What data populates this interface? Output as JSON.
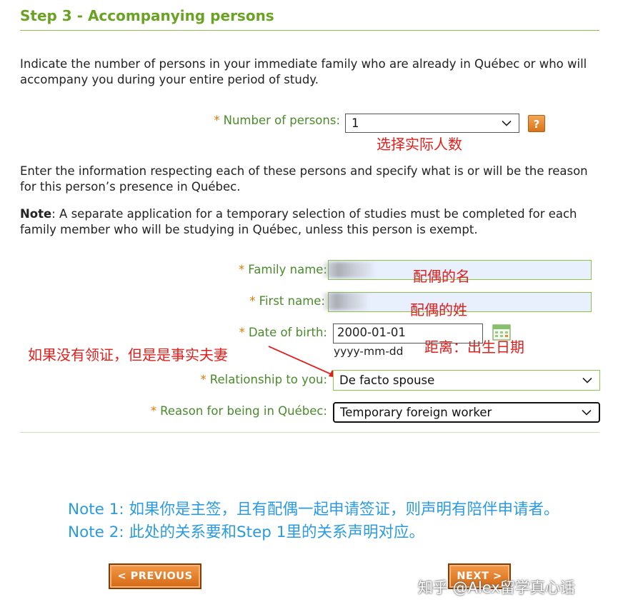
{
  "step_title": "Step 3 - Accompanying persons",
  "intro_text": "Indicate the number of persons in your immediate family who are already in Québec or who will accompany you during your entire period of study.",
  "number_of_persons": {
    "label": "Number of persons:",
    "value": "1",
    "help_label": "?"
  },
  "info_text": "Enter the information respecting each of these persons and specify what is or will be the reason for this person’s presence in Québec.",
  "note": {
    "bold": "Note",
    "text": ": A separate application for a temporary selection of studies must be completed for each family member who will be studying in Québec, unless this person is exempt."
  },
  "fields": {
    "family_name_label": "Family name:",
    "first_name_label": "First name:",
    "dob_label": "Date of birth:",
    "dob_value": "2000-01-01",
    "dob_format": "yyyy-mm-dd",
    "relationship_label": "Relationship to you:",
    "relationship_value": "De facto spouse",
    "reason_label": "Reason for being in Québec:",
    "reason_value": "Temporary foreign worker"
  },
  "annotations": {
    "select_count": "选择实际人数",
    "spouse_given_name": "配偶的名",
    "spouse_family_name": "配偶的姓",
    "dob_hint": "距离：出生日期",
    "de_facto_hint": "如果没有领证，但是是事实夫妻",
    "note1": "Note 1: 如果你是主签，且有配偶一起申请签证，则声明有陪伴申请者。",
    "note2": "Note 2: 此处的关系要和Step 1里的关系声明对应。"
  },
  "buttons": {
    "previous": "< PREVIOUS",
    "next": "NEXT >"
  },
  "watermark": "知乎 @Alex留学真心话",
  "icons": {
    "required": "*",
    "dropdown": "chevron-down-icon",
    "calendar": "calendar-icon"
  }
}
